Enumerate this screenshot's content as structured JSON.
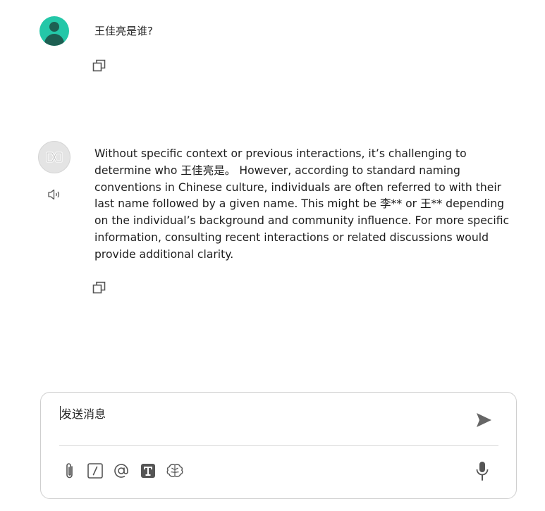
{
  "conversation": {
    "user_message": "王佳亮是谁?",
    "assistant_message": "Without specific context or previous interactions, it’s challenging to determine who 王佳亮是。 However, according to standard naming conventions in Chinese culture, individuals are often referred to with their last name followed by a given name. This might be 李** or 王** depending on the individual’s background and community influence. For more specific information, consulting recent interactions or related discussions would provide additional clarity."
  },
  "composer": {
    "placeholder": "发送消息",
    "tools": [
      "paperclip-icon",
      "slash-command-icon",
      "at-mention-icon",
      "text-format-icon",
      "brain-icon"
    ]
  },
  "colors": {
    "user_avatar_bg": "#24c7a8",
    "user_avatar_fg": "#1d5f52",
    "bot_avatar_bg": "#e4e4e4",
    "icon_gray": "#555555"
  }
}
